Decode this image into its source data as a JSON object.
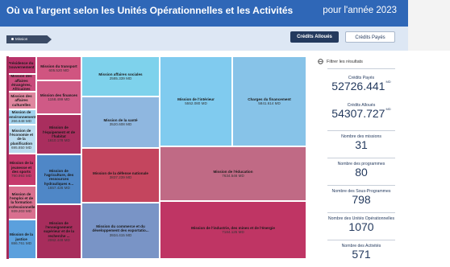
{
  "header": {
    "title": "Où va l'argent selon les Unités Opérationnelles et les Activités",
    "year": "pour l'année 2023"
  },
  "filterbar": {
    "breadcrumb": "Mission",
    "btn_alloues": "Crédits Alloués",
    "btn_payes": "Crédits Payés"
  },
  "treemap": {
    "tiles": [
      {
        "name": "Présidence du Gouvernement",
        "value": "",
        "color": "#b8336a"
      },
      {
        "name": "Mission des affaires étrangères, Africaines",
        "value": "",
        "color": "#c94b7c"
      },
      {
        "name": "Mission des affaires culturelles",
        "value": "",
        "color": "#e0879f"
      },
      {
        "name": "Mission de l'environnement",
        "value": "266.648 MD",
        "color": "#a3d4ef"
      },
      {
        "name": "Mission de l'économie et de la planification",
        "value": "695.850 MD",
        "color": "#bcdcf0"
      },
      {
        "name": "Mission de la jeunesse et des sports",
        "value": "790.993 MD",
        "color": "#c63a6c"
      },
      {
        "name": "Mission de l'emploi et de la formation professionnelle",
        "value": "939.203 MD",
        "color": "#d9708f"
      },
      {
        "name": "Mission de la justice",
        "value": "886.761 MD",
        "color": "#5ba0dd"
      },
      {
        "name": "Mission du transport",
        "value": "605.520 MD",
        "color": "#d05580"
      },
      {
        "name": "Mission des finances",
        "value": "1158.499 MD",
        "color": "#cf5a86"
      },
      {
        "name": "Mission de l'équipement et de l'habitat",
        "value": "1610.178 MD",
        "color": "#a92e5e"
      },
      {
        "name": "Mission de l'agriculture, des ressources hydrauliques e...",
        "value": "1657.426 MD",
        "color": "#4f87c7"
      },
      {
        "name": "Mission de l'enseignement supérieur et de la recherche ...",
        "value": "2062.449 MD",
        "color": "#a72d5c"
      },
      {
        "name": "Mission affaires sociales",
        "value": "2585.339 MD",
        "color": "#7ed2ec"
      },
      {
        "name": "Mission de la santé",
        "value": "3520.608 MD",
        "color": "#8fb7e0"
      },
      {
        "name": "Mission de la défense nationale",
        "value": "3837.239 MD",
        "color": "#c4455e"
      },
      {
        "name": "Mission du commerce et du développement des exportatio...",
        "value": "3934.415 MD",
        "color": "#7994c6"
      },
      {
        "name": "Mission de l'intérieur",
        "value": "5552.080 MD",
        "color": "#80cbef"
      },
      {
        "name": "Charges du financement",
        "value": "5841.614 MD",
        "color": "#87c3e8"
      },
      {
        "name": "Mission de l'éducation",
        "value": "7634.546 MD",
        "color": "#c06a85"
      },
      {
        "name": "Mission de l'industrie, des mines et de l'énergie",
        "value": "7184.125 MD",
        "color": "#bf3564"
      }
    ]
  },
  "side": {
    "filter_label": "Filtrer les résultats",
    "stats": [
      {
        "label": "Crédits Payés",
        "value": "52726.441",
        "unit": "MD"
      },
      {
        "label": "Crédits Alloués",
        "value": "54307.727",
        "unit": "MD"
      },
      {
        "label": "Nombre des missions",
        "value": "31",
        "unit": ""
      },
      {
        "label": "Nombre des programmes",
        "value": "80",
        "unit": ""
      },
      {
        "label": "Nombre des Sous-Programmes",
        "value": "798",
        "unit": ""
      },
      {
        "label": "Nombre des Unités Opérationnelles",
        "value": "1070",
        "unit": ""
      },
      {
        "label": "Nombre des Activités",
        "value": "571",
        "unit": ""
      }
    ]
  }
}
